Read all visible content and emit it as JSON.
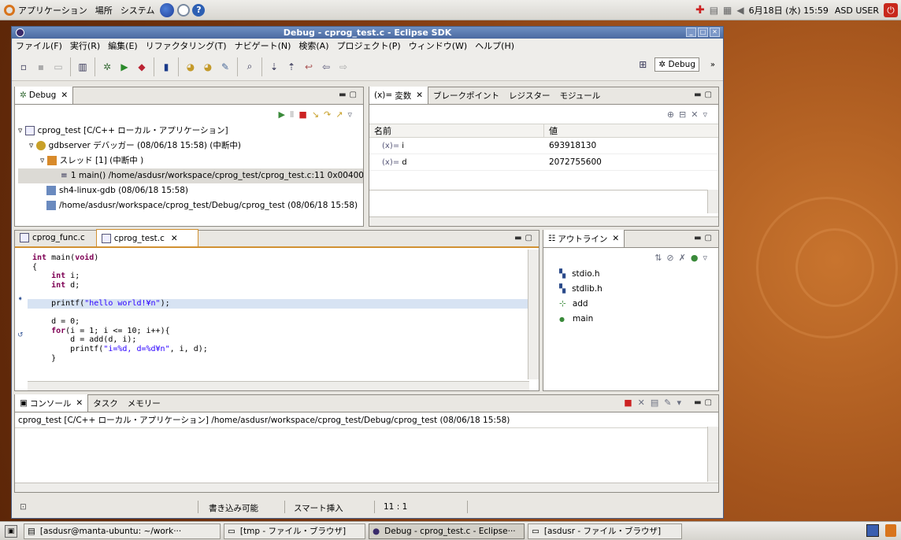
{
  "topbar": {
    "menus": [
      "アプリケーション",
      "場所",
      "システム"
    ],
    "clock": "6月18日 (水) 15:59",
    "user": "ASD USER"
  },
  "window": {
    "title": "Debug - cprog_test.c - Eclipse SDK",
    "menu": [
      "ファイル(F)",
      "実行(R)",
      "編集(E)",
      "リファクタリング(T)",
      "ナビゲート(N)",
      "検索(A)",
      "プロジェクト(P)",
      "ウィンドウ(W)",
      "ヘルプ(H)"
    ],
    "perspective": "Debug"
  },
  "debug_view": {
    "tab": "Debug",
    "items": [
      "cprog_test [C/C++ ローカル・アプリケーション]",
      "gdbserver デバッガー (08/06/18 15:58) (中断中)",
      "スレッド [1] (中断中 )",
      "1 main() /home/asdusr/workspace/cprog_test/cprog_test.c:11 0x00400",
      "sh4-linux-gdb (08/06/18 15:58)",
      "/home/asdusr/workspace/cprog_test/Debug/cprog_test (08/06/18 15:58)"
    ]
  },
  "vars_view": {
    "tabs": [
      "変数",
      "ブレークポイント",
      "レジスター",
      "モジュール"
    ],
    "col_name": "名前",
    "col_value": "値",
    "rows": [
      {
        "name": "i",
        "value": "693918130"
      },
      {
        "name": "d",
        "value": "2072755600"
      }
    ]
  },
  "editor": {
    "tabs": [
      "cprog_func.c",
      "cprog_test.c"
    ],
    "lines": [
      "int main(void)",
      "{",
      "    int i;",
      "    int d;",
      "",
      "    printf(\"hello world!¥n\");",
      "",
      "    d = 0;",
      "    for(i = 1; i <= 10; i++){",
      "        d = add(d, i);",
      "        printf(\"i=%d, d=%d¥n\", i, d);",
      "    }"
    ]
  },
  "outline": {
    "tab": "アウトライン",
    "items": [
      "stdio.h",
      "stdlib.h",
      "add",
      "main"
    ]
  },
  "console": {
    "tabs": [
      "コンソール",
      "タスク",
      "メモリー"
    ],
    "header": "cprog_test [C/C++ ローカル・アプリケーション] /home/asdusr/workspace/cprog_test/Debug/cprog_test (08/06/18 15:58)"
  },
  "status": {
    "writable": "書き込み可能",
    "insert": "スマート挿入",
    "pos": "11 : 1"
  },
  "taskbar": [
    "[asdusr@manta-ubuntu: ~/work···",
    "[tmp - ファイル・ブラウザ]",
    "Debug - cprog_test.c - Eclipse···",
    "[asdusr - ファイル・ブラウザ]"
  ],
  "colors": {
    "title_bar": "#4b6aa1",
    "current_line": "#d7e3f3",
    "active_tab_border": "#d19132"
  }
}
